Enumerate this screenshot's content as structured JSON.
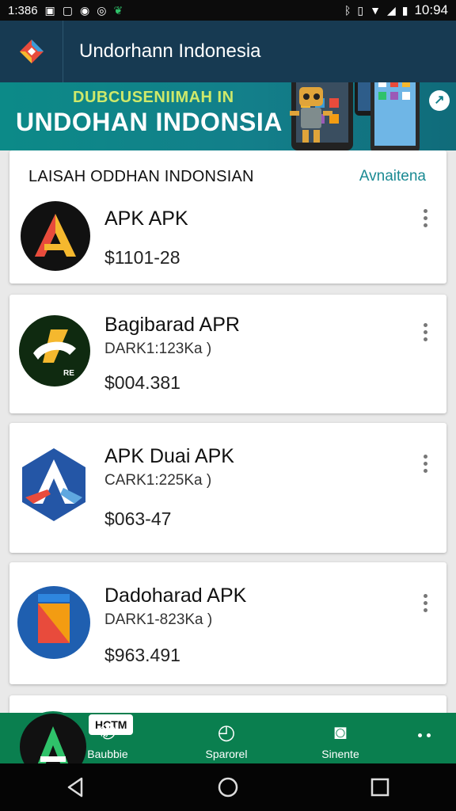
{
  "status_bar": {
    "time_left": "1:386",
    "time_right": "10:94"
  },
  "header": {
    "title": "Undorhann Indonesia"
  },
  "banner": {
    "subtitle": "DUBCUSENIIMAH IN",
    "title": "UNDOHAN INDONSIA"
  },
  "section": {
    "header": "LAISAH ODDHAN INDONSIAN",
    "action": "Avnaitena"
  },
  "apps": [
    {
      "name": "APK APK",
      "meta": "",
      "price": "$1101-28"
    },
    {
      "name": "Bagibarad APR",
      "meta": "DARK1:123Ka )",
      "price": "$004.381",
      "icon_badge": "RE"
    },
    {
      "name": "APK Duai APK",
      "meta": "CARK1:225Ka )",
      "price": "$063-47"
    },
    {
      "name": "Dadoharad APK",
      "meta": "DARK1-823Ka )",
      "price": "$963.491"
    }
  ],
  "bottom_tabs": {
    "fab_label": "HCTM",
    "items": [
      {
        "label": "Baubbie",
        "icon": "chat-bubble-icon"
      },
      {
        "label": "Sparorel",
        "icon": "compass-icon"
      },
      {
        "label": "Sinente",
        "icon": "camera-icon"
      }
    ]
  },
  "colors": {
    "header_bg": "#173a52",
    "banner_bg": "#0c8a88",
    "tab_bar_bg": "#0a7f4f",
    "accent": "#1a8a93"
  }
}
